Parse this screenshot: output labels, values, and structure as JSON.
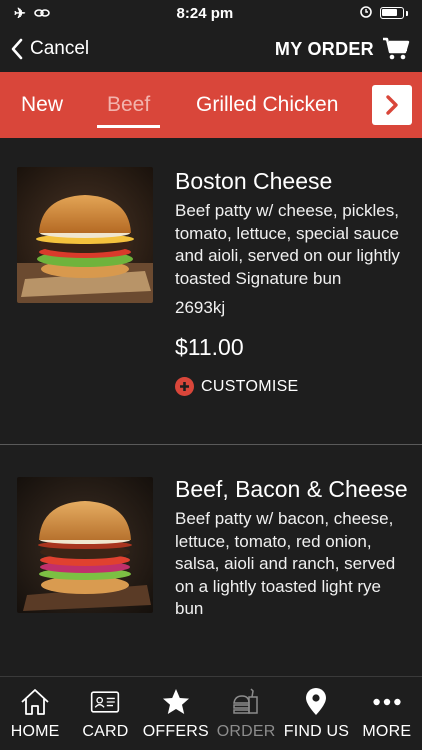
{
  "status": {
    "time": "8:24 pm"
  },
  "nav": {
    "cancel_label": "Cancel",
    "my_order_label": "MY ORDER"
  },
  "tabs": [
    {
      "label": "New",
      "active": false
    },
    {
      "label": "Beef",
      "active": true
    },
    {
      "label": "Grilled Chicken",
      "active": false
    }
  ],
  "items": [
    {
      "name": "Boston Cheese",
      "description": "Beef patty w/ cheese, pickles, tomato, lettuce, special sauce and aioli, served on our lightly toasted Signature bun",
      "energy": "2693kj",
      "price": "$11.00",
      "customise_label": "CUSTOMISE"
    },
    {
      "name": "Beef, Bacon & Cheese",
      "description": "Beef patty w/ bacon, cheese, lettuce, tomato, red onion, salsa, aioli and ranch, served on a lightly toasted light rye bun"
    }
  ],
  "bottom_nav": [
    {
      "label": "HOME",
      "icon": "home-icon"
    },
    {
      "label": "CARD",
      "icon": "card-icon"
    },
    {
      "label": "OFFERS",
      "icon": "star-icon"
    },
    {
      "label": "ORDER",
      "icon": "order-icon"
    },
    {
      "label": "FIND US",
      "icon": "location-pin-icon"
    },
    {
      "label": "MORE",
      "icon": "more-dots-icon"
    }
  ],
  "colors": {
    "accent": "#d9463a",
    "background": "#1e1e1e"
  }
}
